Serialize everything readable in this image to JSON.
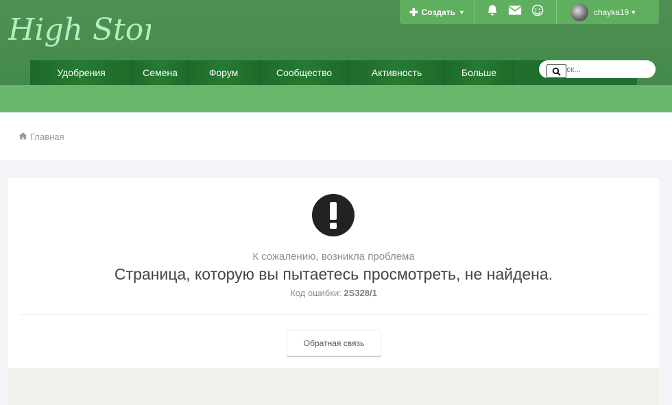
{
  "brand": {
    "logo_text": "High Stone"
  },
  "userbar": {
    "create_label": "Создать",
    "username": "chayka19",
    "icons": [
      "bell-icon",
      "envelope-icon",
      "smiley-icon"
    ]
  },
  "nav": {
    "items": [
      {
        "label": "Удобрения"
      },
      {
        "label": "Семена"
      },
      {
        "label": "Форум"
      },
      {
        "label": "Сообщество"
      },
      {
        "label": "Активность"
      },
      {
        "label": "Больше"
      }
    ]
  },
  "search": {
    "placeholder": "Поиск..."
  },
  "breadcrumb": {
    "home_label": "Главная"
  },
  "error": {
    "subtitle": "К сожалению, возникла проблема",
    "message": "Страница, которую вы пытаетесь просмотреть, не найдена.",
    "code_label": "Код ошибки:",
    "code_value": "2S328/1",
    "feedback_label": "Обратная связь"
  },
  "colors": {
    "header": "#4a8d50",
    "nav": "#1f6e2b",
    "userbar": "#5faf5f",
    "accent_bar": "#67b66b",
    "logo": "#aef0c0"
  }
}
